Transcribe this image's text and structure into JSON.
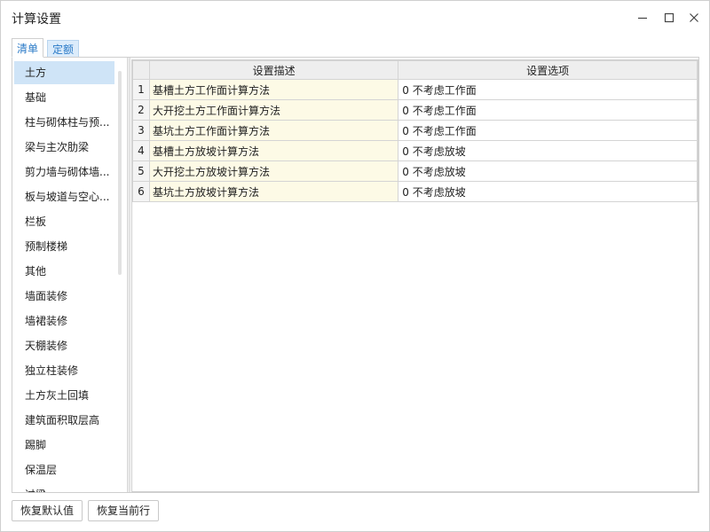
{
  "window": {
    "title": "计算设置"
  },
  "tabs": [
    {
      "label": "清单",
      "active": true
    },
    {
      "label": "定额",
      "active": false
    }
  ],
  "sidebar": {
    "items": [
      {
        "label": "土方",
        "selected": true
      },
      {
        "label": "基础"
      },
      {
        "label": "柱与砌体柱与预..."
      },
      {
        "label": "梁与主次肋梁"
      },
      {
        "label": "剪力墙与砌体墙..."
      },
      {
        "label": "板与坡道与空心..."
      },
      {
        "label": "栏板"
      },
      {
        "label": "预制楼梯"
      },
      {
        "label": "其他"
      },
      {
        "label": "墙面装修"
      },
      {
        "label": "墙裙装修"
      },
      {
        "label": "天棚装修"
      },
      {
        "label": "独立柱装修"
      },
      {
        "label": "土方灰土回填"
      },
      {
        "label": "建筑面积取层高"
      },
      {
        "label": "踢脚"
      },
      {
        "label": "保温层"
      },
      {
        "label": "过梁"
      }
    ]
  },
  "table": {
    "columns": [
      "设置描述",
      "设置选项"
    ],
    "rows": [
      {
        "num": "1",
        "desc": "基槽土方工作面计算方法",
        "option": "0 不考虑工作面"
      },
      {
        "num": "2",
        "desc": "大开挖土方工作面计算方法",
        "option": "0 不考虑工作面"
      },
      {
        "num": "3",
        "desc": "基坑土方工作面计算方法",
        "option": "0 不考虑工作面"
      },
      {
        "num": "4",
        "desc": "基槽土方放坡计算方法",
        "option": "0 不考虑放坡"
      },
      {
        "num": "5",
        "desc": "大开挖土方放坡计算方法",
        "option": "0 不考虑放坡"
      },
      {
        "num": "6",
        "desc": "基坑土方放坡计算方法",
        "option": "0 不考虑放坡"
      }
    ]
  },
  "footer": {
    "restore_default_label": "恢复默认值",
    "restore_current_label": "恢复当前行"
  },
  "colors": {
    "accent": "#2a7ac7",
    "selected_row": "#cfe4f7",
    "desc_cell": "#fdfae6"
  }
}
